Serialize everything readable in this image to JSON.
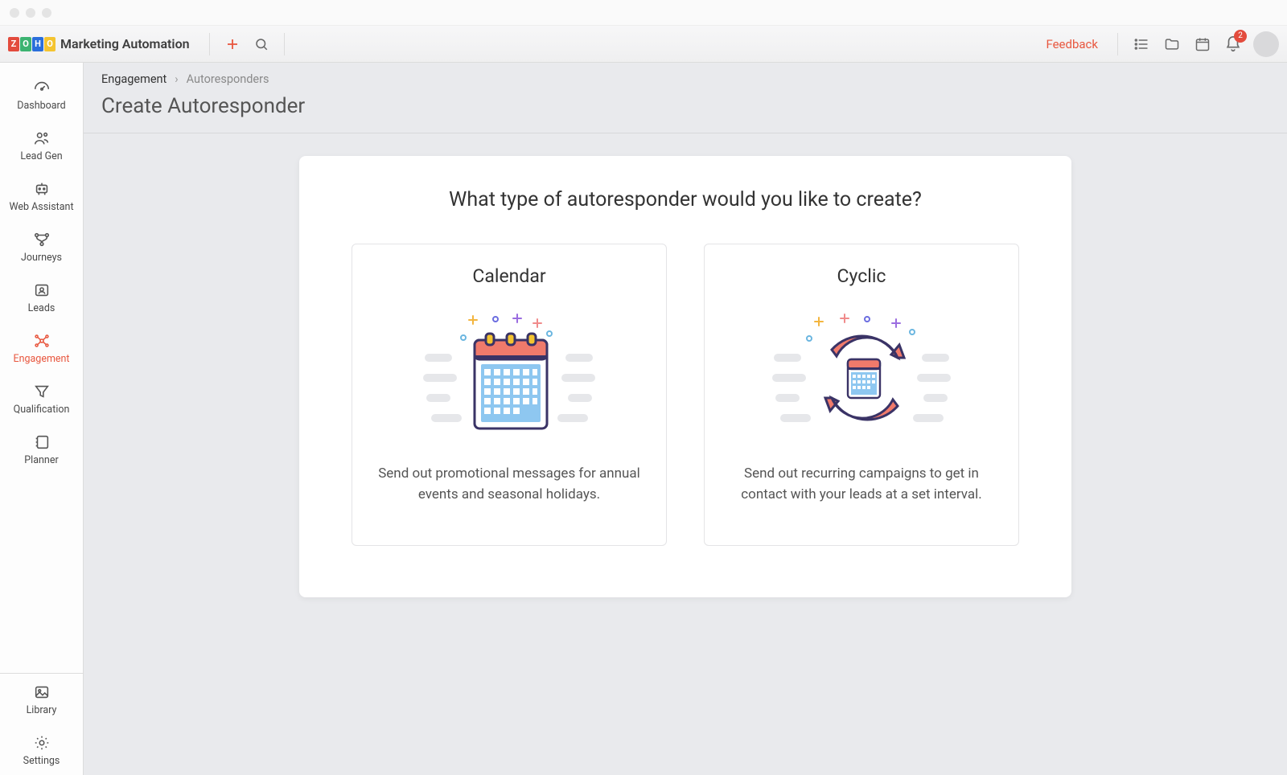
{
  "app": {
    "brand_text": "Marketing Automation",
    "logo_letters": [
      "Z",
      "O",
      "H",
      "O"
    ]
  },
  "topbar": {
    "feedback_label": "Feedback",
    "notification_count": "2"
  },
  "sidebar": {
    "items": [
      {
        "label": "Dashboard"
      },
      {
        "label": "Lead Gen"
      },
      {
        "label": "Web Assistant"
      },
      {
        "label": "Journeys"
      },
      {
        "label": "Leads"
      },
      {
        "label": "Engagement"
      },
      {
        "label": "Qualification"
      },
      {
        "label": "Planner"
      }
    ],
    "bottom": [
      {
        "label": "Library"
      },
      {
        "label": "Settings"
      }
    ],
    "active_index": 5
  },
  "breadcrumb": {
    "root": "Engagement",
    "current": "Autoresponders"
  },
  "page": {
    "title": "Create Autoresponder"
  },
  "panel": {
    "heading": "What type of autoresponder would you like to create?",
    "options": [
      {
        "title": "Calendar",
        "description": "Send out promotional messages for annual events and seasonal holidays."
      },
      {
        "title": "Cyclic",
        "description": "Send out recurring campaigns to get in contact with your leads at a set interval."
      }
    ]
  }
}
